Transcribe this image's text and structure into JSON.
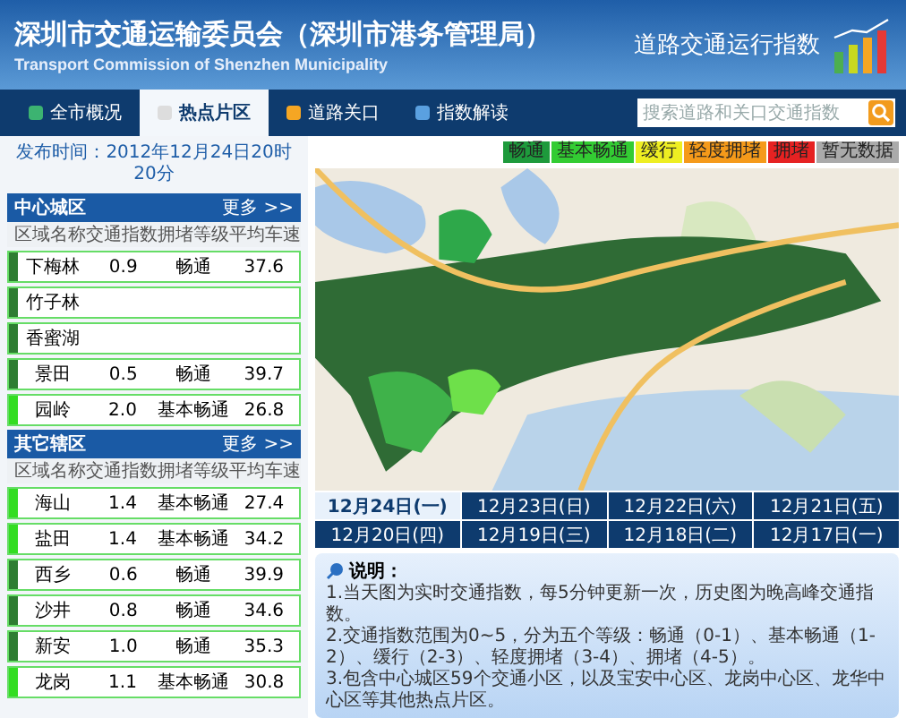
{
  "header": {
    "title": "深圳市交通运输委员会（深圳市港务管理局）",
    "subtitle": "Transport Commission of Shenzhen Municipality",
    "index_title": "道路交通运行指数"
  },
  "nav": {
    "tabs": [
      {
        "label": "全市概况",
        "selected": false
      },
      {
        "label": "热点片区",
        "selected": true
      },
      {
        "label": "道路关口",
        "selected": false
      },
      {
        "label": "指数解读",
        "selected": false
      }
    ],
    "search": {
      "placeholder": "搜索道路和关口交通指数"
    }
  },
  "publish_time": "发布时间：2012年12月24日20时20分",
  "panels": [
    {
      "title": "中心城区",
      "more": "更多 >>",
      "columns": [
        "区域名称",
        "交通指数",
        "拥堵等级",
        "平均车速"
      ],
      "rows": [
        {
          "name": "下梅林",
          "index": "0.9",
          "grade": "畅通",
          "speed": "37.6",
          "color": "#2e7d32"
        },
        {
          "name": "竹子林",
          "color": "#2e7d32"
        },
        {
          "name": "香蜜湖",
          "color": "#2e7d32"
        },
        {
          "name": "景田",
          "index": "0.5",
          "grade": "畅通",
          "speed": "39.7",
          "color": "#2e7d32"
        },
        {
          "name": "园岭",
          "index": "2.0",
          "grade": "基本畅通",
          "speed": "26.8",
          "color": "#33dd22"
        }
      ]
    },
    {
      "title": "其它辖区",
      "more": "更多 >>",
      "columns": [
        "区域名称",
        "交通指数",
        "拥堵等级",
        "平均车速"
      ],
      "rows": [
        {
          "name": "海山",
          "index": "1.4",
          "grade": "基本畅通",
          "speed": "27.4",
          "color": "#33dd22"
        },
        {
          "name": "盐田",
          "index": "1.4",
          "grade": "基本畅通",
          "speed": "34.2",
          "color": "#33dd22"
        },
        {
          "name": "西乡",
          "index": "0.6",
          "grade": "畅通",
          "speed": "39.9",
          "color": "#2e7d32"
        },
        {
          "name": "沙井",
          "index": "0.8",
          "grade": "畅通",
          "speed": "34.6",
          "color": "#2e7d32"
        },
        {
          "name": "新安",
          "index": "1.0",
          "grade": "畅通",
          "speed": "35.3",
          "color": "#2e7d32"
        },
        {
          "name": "龙岗",
          "index": "1.1",
          "grade": "基本畅通",
          "speed": "30.8",
          "color": "#33dd22"
        }
      ]
    }
  ],
  "legend": [
    {
      "label": "畅通",
      "color": "#1e9a3c"
    },
    {
      "label": "基本畅通",
      "color": "#33cc33"
    },
    {
      "label": "缓行",
      "color": "#eeee22"
    },
    {
      "label": "轻度拥堵",
      "color": "#f59a1a"
    },
    {
      "label": "拥堵",
      "color": "#e62222"
    },
    {
      "label": "暂无数据",
      "color": "#aaaaaa"
    }
  ],
  "date_tabs": [
    {
      "label": "12月24日(一)",
      "selected": true
    },
    {
      "label": "12月23日(日)",
      "selected": false
    },
    {
      "label": "12月22日(六)",
      "selected": false
    },
    {
      "label": "12月21日(五)",
      "selected": false
    },
    {
      "label": "12月20日(四)",
      "selected": false
    },
    {
      "label": "12月19日(三)",
      "selected": false
    },
    {
      "label": "12月18日(二)",
      "selected": false
    },
    {
      "label": "12月17日(一)",
      "selected": false
    }
  ],
  "notes": {
    "title": "说明：",
    "items": [
      "1.当天图为实时交通指数，每5分钟更新一次，历史图为晚高峰交通指数。",
      "2.交通指数范围为0~5，分为五个等级：畅通（0-1）、基本畅通（1-2）、缓行（2-3）、轻度拥堵（3-4）、拥堵（4-5）。",
      "3.包含中心城区59个交通小区，以及宝安中心区、龙岗中心区、龙华中心区等其他热点片区。"
    ]
  }
}
